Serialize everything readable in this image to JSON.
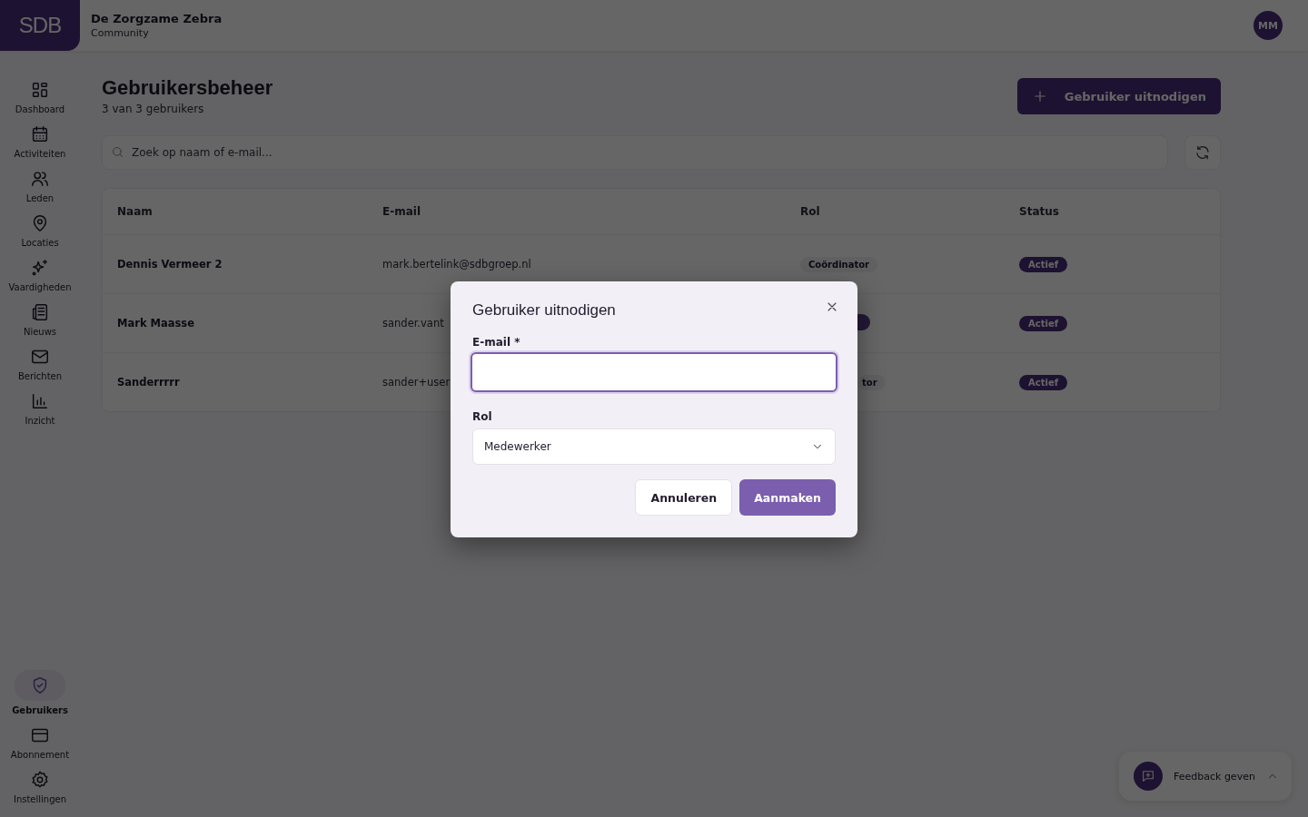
{
  "topbar": {
    "logo": "SDB",
    "org_name": "De Zorgzame Zebra",
    "org_type": "Community",
    "avatar": "MM"
  },
  "sidebar": {
    "items": [
      {
        "label": "Dashboard",
        "selected": false
      },
      {
        "label": "Activiteiten",
        "selected": false
      },
      {
        "label": "Leden",
        "selected": false
      },
      {
        "label": "Locaties",
        "selected": false
      },
      {
        "label": "Vaardigheden",
        "selected": false
      },
      {
        "label": "Nieuws",
        "selected": false
      },
      {
        "label": "Berichten",
        "selected": false
      },
      {
        "label": "Inzicht",
        "selected": false
      }
    ],
    "bottom_items": [
      {
        "label": "Gebruikers",
        "selected": true
      },
      {
        "label": "Abonnement",
        "selected": false
      },
      {
        "label": "Instellingen",
        "selected": false
      }
    ]
  },
  "page": {
    "title": "Gebruikersbeheer",
    "subtitle": "3 van 3 gebruikers",
    "invite_button": "Gebruiker uitnodigen",
    "search": {
      "placeholder": "Zoek op naam of e-mail..."
    }
  },
  "table": {
    "columns": [
      "Naam",
      "E-mail",
      "Rol",
      "Status"
    ],
    "rows": [
      {
        "name": "Dennis Vermeer 2",
        "email": "mark.bertelink@sdbgroep.nl",
        "role": "Coördinator",
        "kind": "full",
        "status": "Actief"
      },
      {
        "name": "Mark Maasse",
        "email": "sander.vant",
        "kind": "cut",
        "status": "Actief"
      },
      {
        "name": "Sanderrrrr",
        "email": "sander+user",
        "role": "tor",
        "kind": "cut",
        "status": "Actief"
      }
    ]
  },
  "dialog": {
    "title": "Gebruiker uitnodigen",
    "email_label": "E-mail *",
    "email_focused": true,
    "role_label": "Rol",
    "role_value": "Medewerker",
    "cancel": "Annuleren",
    "submit": "Aanmaken"
  },
  "feedback": {
    "label": "Feedback geven"
  }
}
